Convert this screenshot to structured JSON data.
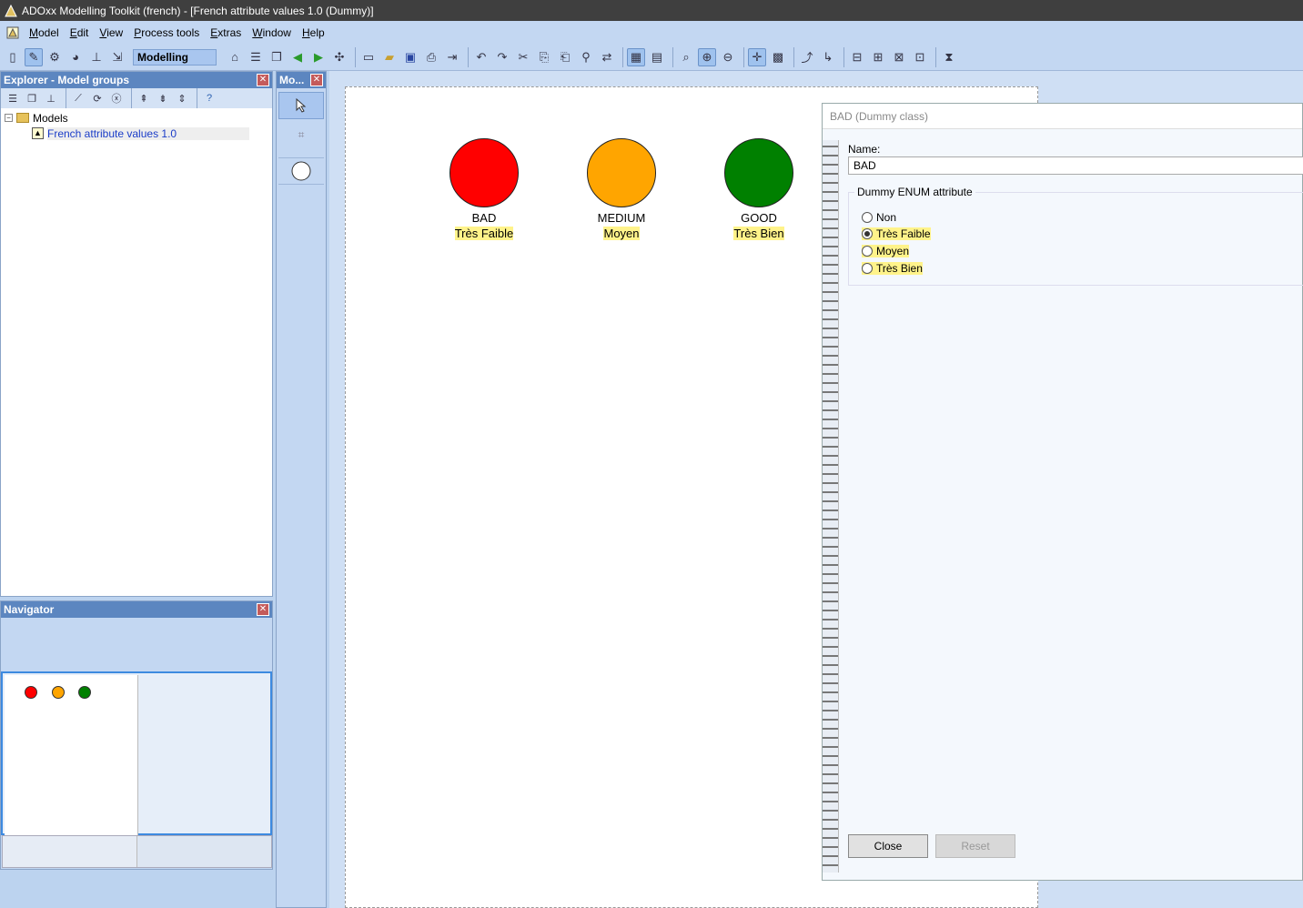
{
  "window": {
    "title": "ADOxx Modelling Toolkit (french) - [French attribute values 1.0 (Dummy)]"
  },
  "menu": [
    "Model",
    "Edit",
    "View",
    "Process tools",
    "Extras",
    "Window",
    "Help"
  ],
  "toolbar": {
    "mode_label": "Modelling"
  },
  "explorer": {
    "title": "Explorer - Model groups",
    "root_label": "Models",
    "model_label": "French attribute values 1.0"
  },
  "navigator": {
    "title": "Navigator"
  },
  "modeller": {
    "title": "Mo..."
  },
  "canvas": {
    "nodes": [
      {
        "name": "BAD",
        "value": "Très Faible",
        "color": "#ff0000"
      },
      {
        "name": "MEDIUM",
        "value": "Moyen",
        "color": "#ffa500"
      },
      {
        "name": "GOOD",
        "value": "Très Bien",
        "color": "#008000"
      }
    ]
  },
  "dialog": {
    "title": "BAD (Dummy class)",
    "name_label": "Name:",
    "name_value": "BAD",
    "group_label": "Dummy ENUM attribute",
    "options": [
      {
        "label": "Non",
        "selected": false,
        "highlighted": false
      },
      {
        "label": "Très Faible",
        "selected": true,
        "highlighted": true
      },
      {
        "label": "Moyen",
        "selected": false,
        "highlighted": true
      },
      {
        "label": "Très Bien",
        "selected": false,
        "highlighted": true
      }
    ],
    "close_label": "Close",
    "reset_label": "Reset"
  },
  "colors": {
    "accent": "#5c86c0",
    "highlight": "#fff38a"
  }
}
